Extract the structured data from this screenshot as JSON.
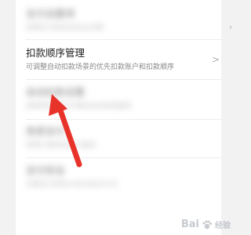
{
  "settings": {
    "items": [
      {
        "title": "支付设置项",
        "subtitle": "管理支付相关的安全设置",
        "blurred": true
      },
      {
        "title": "扣款顺序管理",
        "subtitle": "可调整自动扣款场景的优先扣款账户和扣款顺序",
        "blurred": false
      },
      {
        "title": "自动扣款设置",
        "subtitle": "查看和管理已开通的自动扣款服务",
        "blurred": true
      },
      {
        "title": "免密支付",
        "subtitle": "管理小额免密支付服务",
        "blurred": true
      },
      {
        "title": "支付安全",
        "subtitle": "设置支付密码与安全验证方式",
        "blurred": true
      }
    ],
    "chevron": ">"
  },
  "annotation": {
    "arrow_color": "#e8332a"
  },
  "watermark": {
    "text": "Bai",
    "paw_icon": "paw-icon",
    "suffix": "经验"
  }
}
